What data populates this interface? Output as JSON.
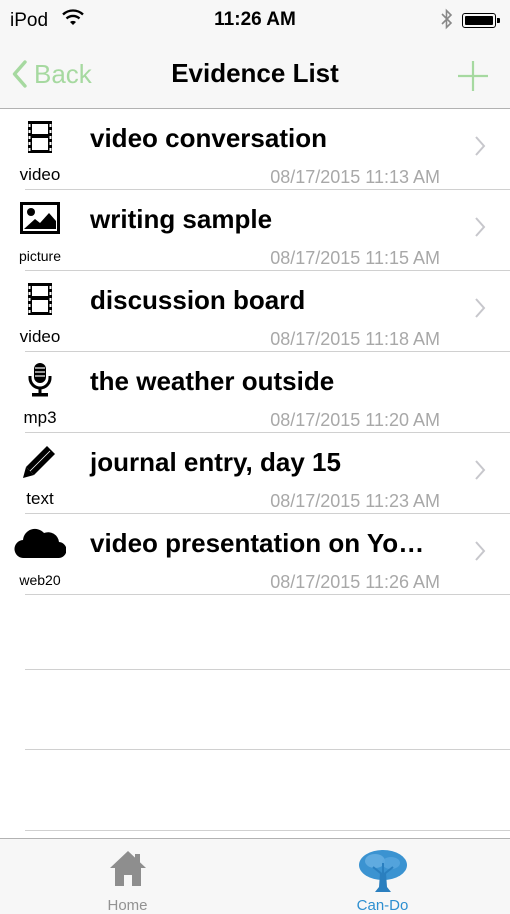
{
  "status": {
    "carrier": "iPod",
    "time": "11:26 AM"
  },
  "nav": {
    "back_label": "Back",
    "title": "Evidence List"
  },
  "items": [
    {
      "icon": "film-icon",
      "type": "video",
      "title": "video conversation",
      "date": "08/17/2015 11:13 AM"
    },
    {
      "icon": "picture-icon",
      "type": "picture",
      "title": "writing sample",
      "date": "08/17/2015 11:15 AM"
    },
    {
      "icon": "film-icon",
      "type": "video",
      "title": "discussion board",
      "date": "08/17/2015 11:18 AM"
    },
    {
      "icon": "microphone-icon",
      "type": "mp3",
      "title": "the weather outside",
      "date": "08/17/2015 11:20 AM"
    },
    {
      "icon": "pencil-icon",
      "type": "text",
      "title": "journal entry, day 15",
      "date": "08/17/2015 11:23 AM"
    },
    {
      "icon": "cloud-icon",
      "type": "web20",
      "title": "video presentation on Yo…",
      "date": "08/17/2015 11:26 AM"
    }
  ],
  "tabs": [
    {
      "label": "Home",
      "icon": "house-icon",
      "color": "#929292"
    },
    {
      "label": "Can-Do",
      "icon": "tree-icon",
      "color": "#2d8fd0"
    }
  ],
  "colors": {
    "accent_green": "#a6d9a0",
    "date_gray": "#a8a8a8",
    "active_tab_blue": "#2d8fd0"
  }
}
